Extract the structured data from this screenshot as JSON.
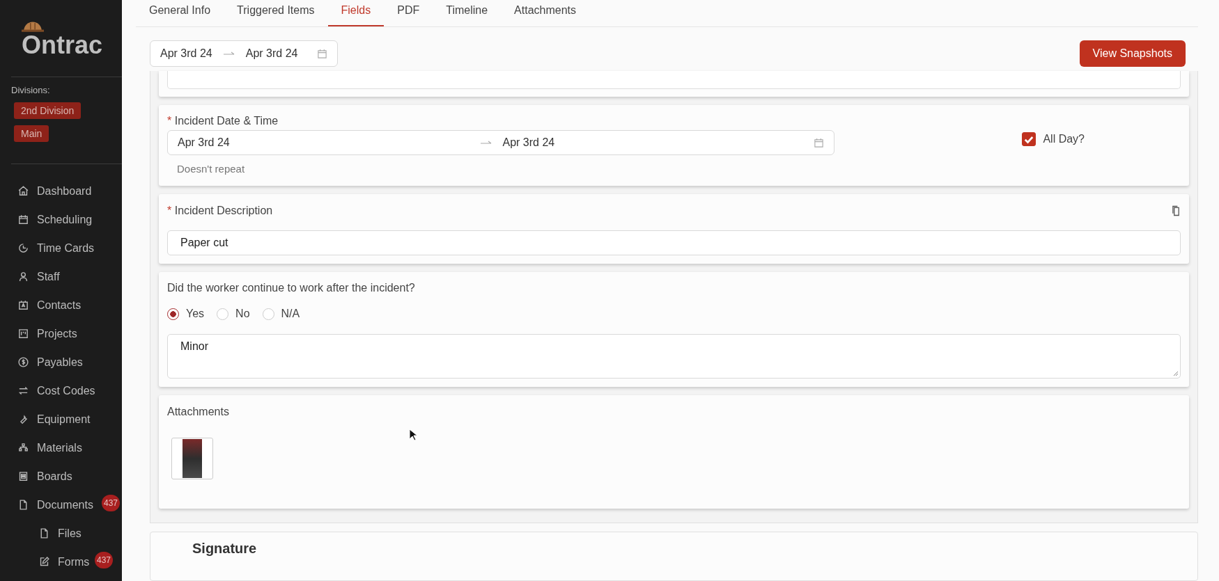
{
  "sidebar": {
    "logo": "Ontrac",
    "divisions_label": "Divisions:",
    "divisions": [
      "2nd Division",
      "Main"
    ],
    "nav": [
      {
        "label": "Dashboard"
      },
      {
        "label": "Scheduling"
      },
      {
        "label": "Time Cards"
      },
      {
        "label": "Staff"
      },
      {
        "label": "Contacts"
      },
      {
        "label": "Projects"
      },
      {
        "label": "Payables"
      },
      {
        "label": "Cost Codes"
      },
      {
        "label": "Equipment"
      },
      {
        "label": "Materials"
      },
      {
        "label": "Boards"
      },
      {
        "label": "Documents",
        "badge": "437",
        "children": [
          {
            "label": "Files"
          },
          {
            "label": "Forms",
            "badge": "437"
          }
        ]
      }
    ]
  },
  "tabs": [
    {
      "label": "General Info",
      "selected": false
    },
    {
      "label": "Triggered Items",
      "selected": false
    },
    {
      "label": "Fields",
      "selected": true
    },
    {
      "label": "PDF",
      "selected": false
    },
    {
      "label": "Timeline",
      "selected": false
    },
    {
      "label": "Attachments",
      "selected": false
    }
  ],
  "date_filter": {
    "start": "Apr 3rd 24",
    "end": "Apr 3rd 24"
  },
  "snapshots_button": "View Snapshots",
  "cards": [
    {
      "kind": "address"
    },
    {
      "kind": "date_range",
      "required_mark": "*",
      "label": "Incident Date & Time",
      "start": "Apr 3rd 24",
      "end": "Apr 3rd 24",
      "repeat": "Doesn't repeat",
      "all_day": {
        "label": "All Day?",
        "checked": true
      }
    },
    {
      "kind": "text",
      "required_mark": "*",
      "label": "Incident Description",
      "value": "Paper cut"
    },
    {
      "kind": "radio",
      "label": "Did the worker continue to work after the incident?",
      "options": [
        {
          "label": "Yes",
          "selected": true
        },
        {
          "label": "No",
          "selected": false
        },
        {
          "label": "N/A",
          "selected": false
        }
      ],
      "notes": "Minor"
    },
    {
      "kind": "attachments",
      "label": "Attachments"
    }
  ],
  "signature": {
    "title": "Signature"
  }
}
